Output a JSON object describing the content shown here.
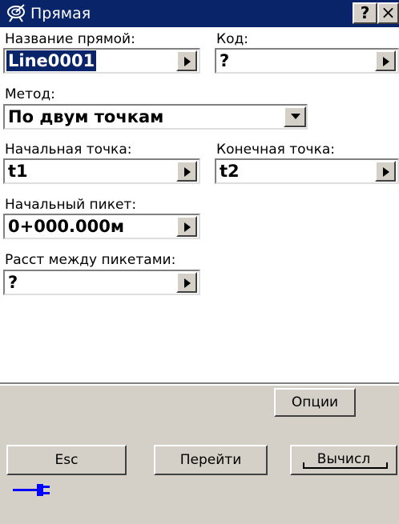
{
  "window": {
    "title": "Прямая",
    "help_label": "?",
    "close_label": "×"
  },
  "form": {
    "line_name_label": "Название прямой:",
    "line_name_value": "Line0001",
    "code_label": "Код:",
    "code_value": "?",
    "method_label": "Метод:",
    "method_value": "По двум точкам",
    "start_point_label": "Начальная точка:",
    "start_point_value": "t1",
    "end_point_label": "Конечная точка:",
    "end_point_value": "t2",
    "start_station_label": "Начальный пикет:",
    "start_station_value": "0+000.000м",
    "station_interval_label": "Расст между пикетами:",
    "station_interval_value": "?"
  },
  "buttons": {
    "options": "Опции",
    "esc": "Esc",
    "goto": "Перейти",
    "compute": "Вычисл"
  },
  "icons": {
    "app": "satellite-dish-icon",
    "status": "power-plug-icon"
  },
  "colors": {
    "titlebar": "#0a246a",
    "selection": "#0a246a",
    "panel": "#d4d0c8",
    "plug": "#0000ff"
  }
}
